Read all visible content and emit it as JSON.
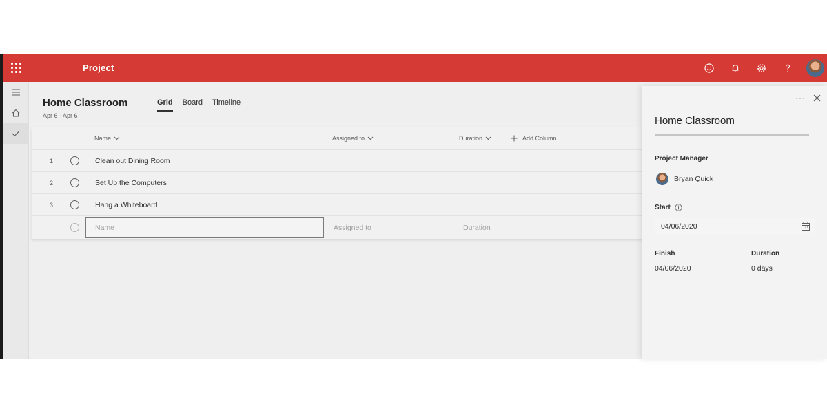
{
  "app": {
    "title": "Project",
    "accent": "#d63a34"
  },
  "header_icons": [
    "smiley-icon",
    "bell-icon",
    "gear-icon",
    "help-icon",
    "avatar"
  ],
  "rail": [
    "hamburger-icon",
    "home-icon",
    "checkmark-icon"
  ],
  "project": {
    "title": "Home Classroom",
    "dates": "Apr 6 - Apr 6"
  },
  "tabs": [
    {
      "label": "Grid",
      "active": true
    },
    {
      "label": "Board",
      "active": false
    },
    {
      "label": "Timeline",
      "active": false
    }
  ],
  "grid": {
    "columns": {
      "name": "Name",
      "assigned": "Assigned to",
      "duration": "Duration",
      "add_column": "Add Column"
    },
    "rows": [
      {
        "num": "1",
        "name": "Clean out Dining Room"
      },
      {
        "num": "2",
        "name": "Set Up the Computers"
      },
      {
        "num": "3",
        "name": "Hang a Whiteboard"
      }
    ],
    "new_row": {
      "name_placeholder": "Name",
      "assigned_placeholder": "Assigned to",
      "duration_placeholder": "Duration"
    }
  },
  "panel": {
    "title": "Home Classroom",
    "pm_label": "Project Manager",
    "pm_name": "Bryan Quick",
    "start_label": "Start",
    "start_value": "04/06/2020",
    "finish_label": "Finish",
    "finish_value": "04/06/2020",
    "duration_label": "Duration",
    "duration_value": "0 days"
  }
}
